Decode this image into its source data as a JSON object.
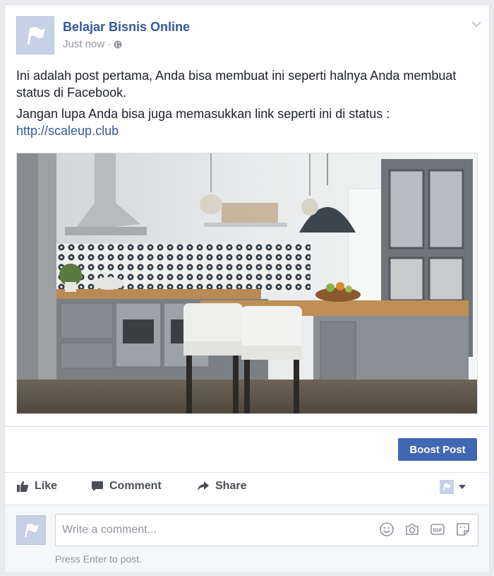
{
  "post": {
    "page_name": "Belajar Bisnis Online",
    "timestamp": "Just now",
    "separator": "·",
    "audience_icon": "globe-icon",
    "paragraph1": "Ini adalah post pertama, Anda bisa membuat ini seperti halnya Anda membuat status di Facebook.",
    "paragraph2_text": "Jangan lupa Anda bisa juga memasukkan link seperti ini di status :",
    "link": "http://scaleup.club",
    "image_icon": "kitchen-photo"
  },
  "boost": {
    "label": "Boost Post"
  },
  "actions": {
    "like": "Like",
    "comment": "Comment",
    "share": "Share"
  },
  "comment_box": {
    "placeholder": "Write a comment...",
    "hint": "Press Enter to post.",
    "icons": [
      "emoji-icon",
      "camera-icon",
      "gif-icon",
      "sticker-icon"
    ]
  },
  "colors": {
    "link": "#365899",
    "boost": "#4267b2",
    "text": "#1d2129",
    "muted": "#90949c"
  }
}
